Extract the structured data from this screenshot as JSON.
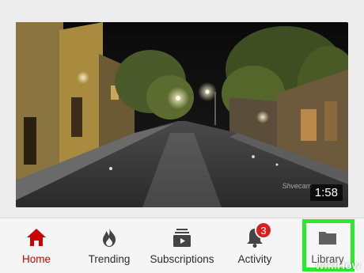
{
  "video": {
    "duration": "1:58",
    "watermark": "Shvecam",
    "thumbnail_description_icon": "street-night-thumbnail"
  },
  "nav": {
    "items": [
      {
        "label": "Home",
        "icon": "home-icon",
        "active": true
      },
      {
        "label": "Trending",
        "icon": "flame-icon",
        "active": false
      },
      {
        "label": "Subscriptions",
        "icon": "subscriptions-icon",
        "active": false
      },
      {
        "label": "Activity",
        "icon": "bell-icon",
        "active": false,
        "badge": "3"
      },
      {
        "label": "Library",
        "icon": "folder-icon",
        "active": false
      }
    ]
  },
  "colors": {
    "accent": "#cc0000",
    "highlight": "#2ee82e",
    "badge": "#d81f1f"
  },
  "watermark": {
    "brand_prefix": "wiki",
    "brand_suffix": "How"
  }
}
